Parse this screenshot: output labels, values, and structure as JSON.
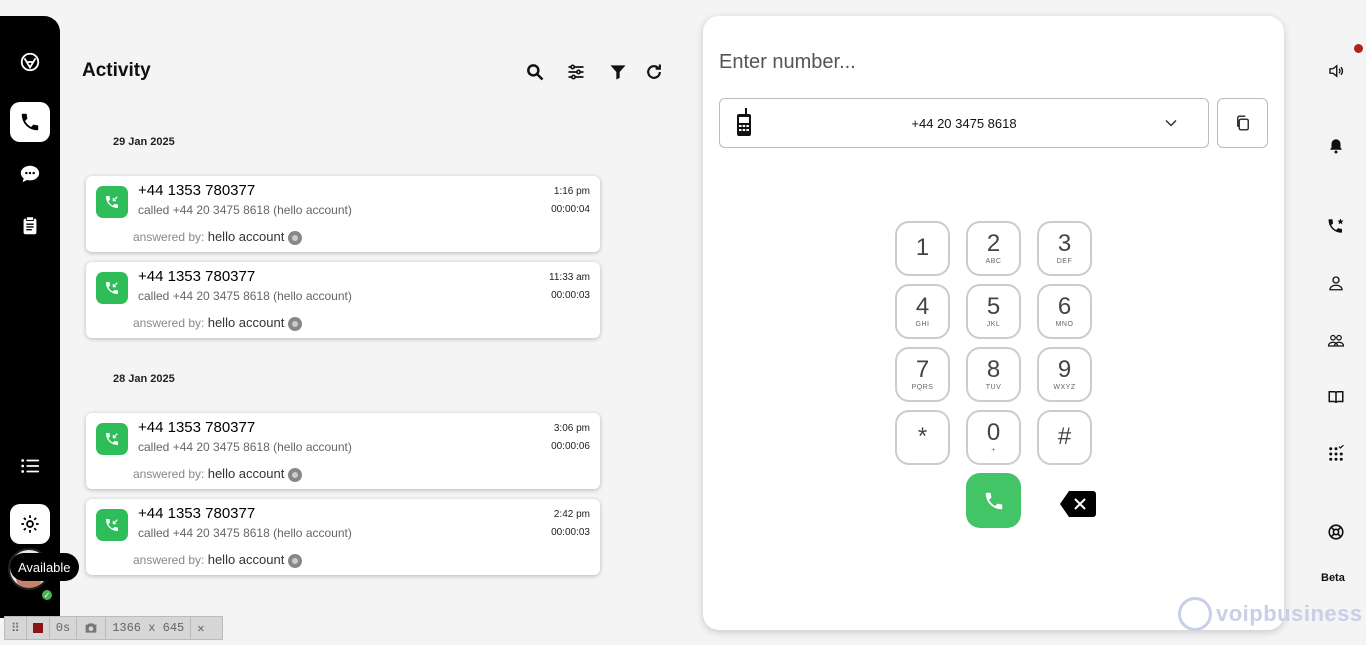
{
  "app": {
    "status_tooltip": "Available"
  },
  "activity": {
    "title": "Activity",
    "groups": [
      {
        "date": "29 Jan 2025",
        "calls": [
          {
            "number": "+44 1353 780377",
            "called_prefix": "called ",
            "called_number": "+44 20 3475 8618",
            "called_suffix": " (hello account)",
            "time": "1:16 pm",
            "duration": "00:00:04",
            "answered_label": "answered by:",
            "answered_by": "hello account"
          },
          {
            "number": "+44 1353 780377",
            "called_prefix": "called ",
            "called_number": "+44 20 3475 8618",
            "called_suffix": " (hello account)",
            "time": "11:33 am",
            "duration": "00:00:03",
            "answered_label": "answered by:",
            "answered_by": "hello account"
          }
        ]
      },
      {
        "date": "28 Jan 2025",
        "calls": [
          {
            "number": "+44 1353 780377",
            "called_prefix": "called ",
            "called_number": "+44 20 3475 8618",
            "called_suffix": " (hello account)",
            "time": "3:06 pm",
            "duration": "00:00:06",
            "answered_label": "answered by:",
            "answered_by": "hello account"
          },
          {
            "number": "+44 1353 780377",
            "called_prefix": "called ",
            "called_number": "+44 20 3475 8618",
            "called_suffix": " (hello account)",
            "time": "2:42 pm",
            "duration": "00:00:03",
            "answered_label": "answered by:",
            "answered_by": "hello account"
          }
        ]
      }
    ]
  },
  "dialer": {
    "input_placeholder": "Enter number...",
    "input_value": "",
    "caller_id": "+44 20 3475 8618",
    "keys": [
      {
        "digit": "1",
        "letters": ""
      },
      {
        "digit": "2",
        "letters": "ABC"
      },
      {
        "digit": "3",
        "letters": "DEF"
      },
      {
        "digit": "4",
        "letters": "GHI"
      },
      {
        "digit": "5",
        "letters": "JKL"
      },
      {
        "digit": "6",
        "letters": "MNO"
      },
      {
        "digit": "7",
        "letters": "PQRS"
      },
      {
        "digit": "8",
        "letters": "TUV"
      },
      {
        "digit": "9",
        "letters": "WXYZ"
      },
      {
        "digit": "*",
        "letters": ""
      },
      {
        "digit": "0",
        "letters": "+"
      },
      {
        "digit": "#",
        "letters": ""
      }
    ]
  },
  "right_rail": {
    "beta_label": "Beta",
    "notification_dot_color": "#b22020"
  },
  "watermark": {
    "text": "voipbusiness"
  },
  "recorder": {
    "elapsed": "0s",
    "dimensions": "1366 x 645"
  },
  "colors": {
    "accent_green": "#2ebd59",
    "call_button_green": "#43c466"
  }
}
